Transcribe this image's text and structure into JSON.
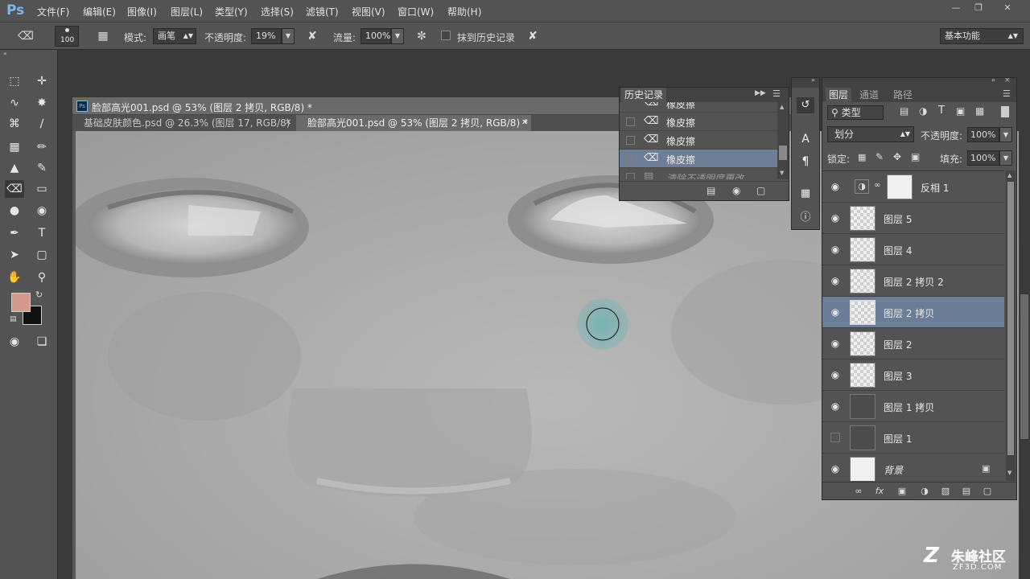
{
  "app": {
    "logo": "Ps"
  },
  "menu": [
    "文件(F)",
    "编辑(E)",
    "图像(I)",
    "图层(L)",
    "类型(Y)",
    "选择(S)",
    "滤镜(T)",
    "视图(V)",
    "窗口(W)",
    "帮助(H)"
  ],
  "options": {
    "brush_size": "100",
    "mode_label": "模式:",
    "mode_value": "画笔",
    "opacity_label": "不透明度:",
    "opacity_value": "19%",
    "flow_label": "流量:",
    "flow_value": "100%",
    "erase_history_label": "抹到历史记录",
    "workspace": "基本功能"
  },
  "document": {
    "title": "脸部高光001.psd @ 53% (图层 2 拷贝, RGB/8) *",
    "tabs": [
      {
        "label": "基础皮肤颜色.psd @ 26.3% (图层 17, RGB/8)"
      },
      {
        "label": "脸部高光001.psd @ 53% (图层 2 拷贝, RGB/8) *"
      }
    ]
  },
  "colors": {
    "foreground": "#d49a8e",
    "background": "#111111",
    "selection": "#6b7d97"
  },
  "history": {
    "title": "历史记录",
    "items": [
      {
        "label": "橡皮擦"
      },
      {
        "label": "橡皮擦"
      },
      {
        "label": "橡皮擦"
      },
      {
        "label": "清除不透明度更改"
      }
    ]
  },
  "layers": {
    "tabs": [
      "图层",
      "通道",
      "路径"
    ],
    "filter_value": "类型",
    "blend_mode": "划分",
    "opacity_label": "不透明度:",
    "opacity_value": "100%",
    "lock_label": "锁定:",
    "fill_label": "填充:",
    "fill_value": "100%",
    "items": [
      {
        "name": "反相 1"
      },
      {
        "name": "图层 5"
      },
      {
        "name": "图层 4"
      },
      {
        "name": "图层 2 拷贝 2"
      },
      {
        "name": "图层 2 拷贝"
      },
      {
        "name": "图层 2"
      },
      {
        "name": "图层 3"
      },
      {
        "name": "图层 1 拷贝"
      },
      {
        "name": "图层 1"
      },
      {
        "name": "背景"
      }
    ]
  },
  "watermark": {
    "text": "朱峰社区",
    "url": "ZF3D.COM"
  }
}
